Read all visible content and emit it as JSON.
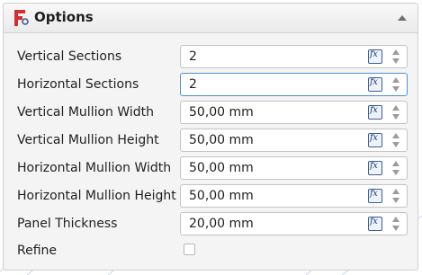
{
  "panel": {
    "title": "Options",
    "icons": {
      "logo": "freecad-logo-icon",
      "collapse": "chevron-up-icon",
      "expression": "fx-icon",
      "spinner": "spinner-arrows-icon"
    },
    "colors": {
      "accent": "#4a90d9",
      "logo_red": "#d42e2e",
      "fx_blue": "#1e3f7a"
    }
  },
  "fields": [
    {
      "label": "Vertical Sections",
      "value": "2",
      "focused": false
    },
    {
      "label": "Horizontal Sections",
      "value": "2",
      "focused": true
    },
    {
      "label": "Vertical Mullion Width",
      "value": "50,00 mm",
      "focused": false
    },
    {
      "label": "Vertical Mullion Height",
      "value": "50,00 mm",
      "focused": false
    },
    {
      "label": "Horizontal Mullion Width",
      "value": "50,00 mm",
      "focused": false
    },
    {
      "label": "Horizontal Mullion Height",
      "value": "50,00 mm",
      "focused": false
    },
    {
      "label": "Panel Thickness",
      "value": "20,00 mm",
      "focused": false
    }
  ],
  "refine": {
    "label": "Refine",
    "checked": false
  },
  "fx_label": "fx"
}
